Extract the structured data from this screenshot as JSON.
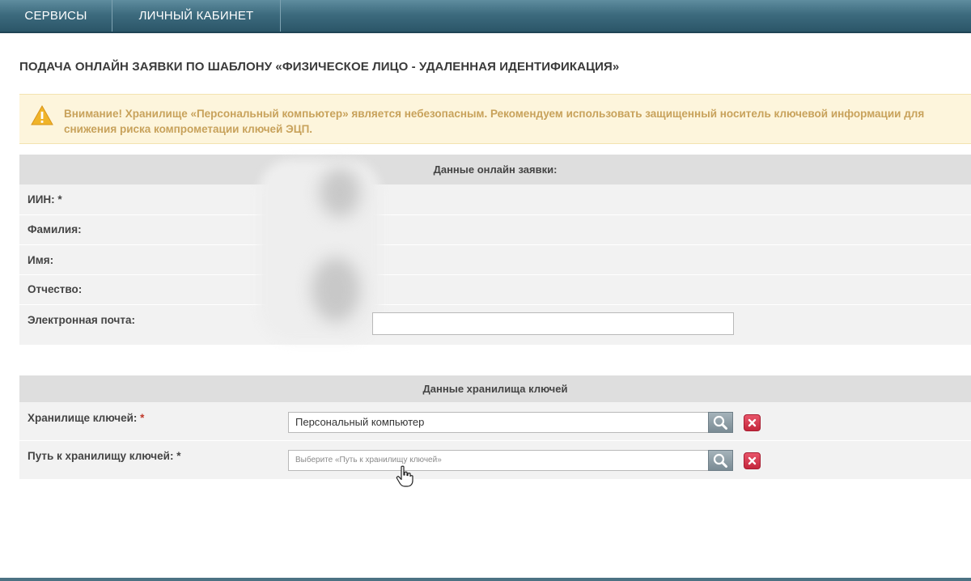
{
  "nav": {
    "services": "СЕРВИСЫ",
    "cabinet": "ЛИЧНЫЙ КАБИНЕТ"
  },
  "page": {
    "title": "ПОДАЧА ОНЛАЙН ЗАЯВКИ ПО ШАБЛОНУ «ФИЗИЧЕСКОЕ ЛИЦО - УДАЛЕННАЯ ИДЕНТИФИКАЦИЯ»"
  },
  "warning": {
    "text": "Внимание! Хранилище «Персональный компьютер» является небезопасным. Рекомендуем использовать защищенный носитель ключевой информации для снижения риска компрометации ключей ЭЦП."
  },
  "online_section": {
    "header": "Данные онлайн заявки:",
    "iin_label": "ИИН:",
    "iin_req": "*",
    "surname_label": "Фамилия:",
    "name_label": "Имя:",
    "patronymic_label": "Отчество:",
    "email_label": "Электронная почта:"
  },
  "keys_section": {
    "header": "Данные хранилища ключей",
    "storage_label": "Хранилище ключей:",
    "storage_req": "*",
    "storage_value": "Персональный компьютер",
    "path_label": "Путь к хранилищу ключей:",
    "path_req": "*",
    "path_placeholder": "Выберите «Путь к хранилищу ключей»"
  },
  "colors": {
    "nav_bg": "#3d6b7e",
    "warning_bg": "#fdf5dc",
    "warning_text": "#c8a25b",
    "required": "#c0392b",
    "clear_button": "#c4263b"
  },
  "icons": {
    "warning": "warning-triangle-icon",
    "search": "search-icon",
    "clear": "close-icon",
    "cursor": "hand-pointer-icon"
  }
}
